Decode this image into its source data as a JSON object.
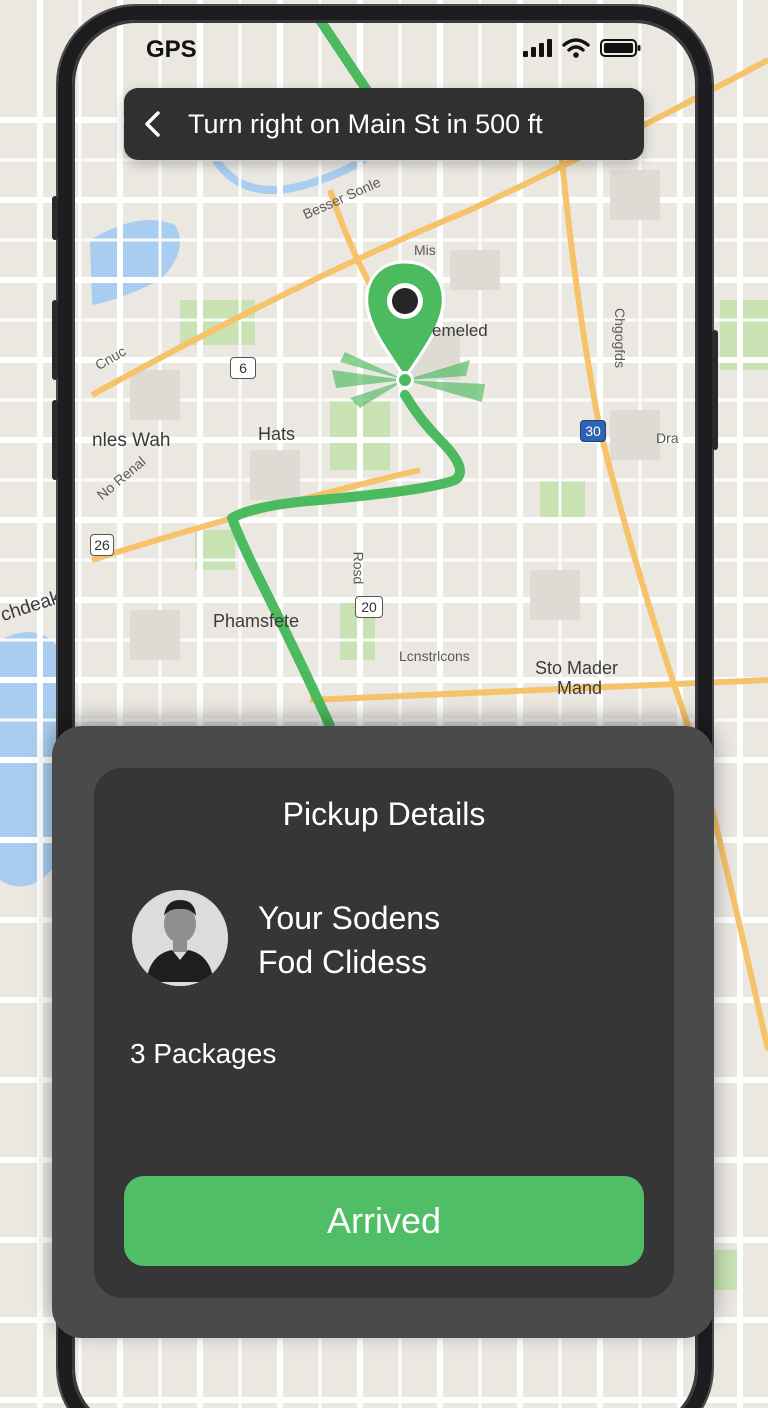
{
  "status_bar": {
    "label": "GPS",
    "icons": [
      "signal-icon",
      "wifi-icon",
      "battery-icon"
    ]
  },
  "navigation": {
    "back_icon": "chevron-left-icon",
    "instruction": "Turn right on Main St in 500 ft"
  },
  "map": {
    "labels": {
      "besser": "Besser Sonle",
      "mis": "Mis",
      "emeled": "emeled",
      "chgogfds": "Chgogfds",
      "nles_wah": "nles Wah",
      "hats": "Hats",
      "phamsfete": "Phamsfete",
      "rosd": "Rosd",
      "lcnstrlcons": "Lcnstrlcons",
      "sto_mader": "Sto Mader",
      "mand": "Mand",
      "chdeak": "chdeak",
      "no_renal": "No Renal",
      "cnuc": "Cnuc",
      "dra": "Dra"
    },
    "route_shields": {
      "six": "6",
      "twenty_six": "26",
      "twenty": "20",
      "thirty": "30"
    },
    "colors": {
      "route": "#4cbb5f",
      "water": "#a9cdf0",
      "park": "#c8e2b3",
      "highway": "#f6c36b"
    }
  },
  "pickup": {
    "title": "Pickup Details",
    "customer_line1": "Your Sodens",
    "customer_line2": "Fod Clidess",
    "packages": "3 Packages",
    "arrived_label": "Arrived",
    "accent": "#4fbe67"
  }
}
